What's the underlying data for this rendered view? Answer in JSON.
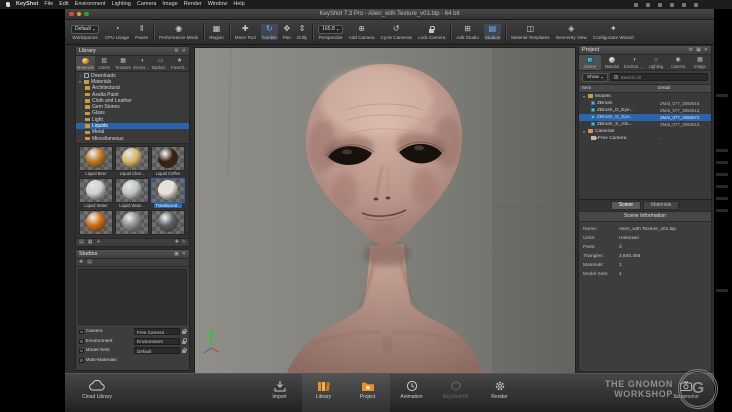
{
  "colors": {
    "selection_blue": "#2a64ad",
    "keyshot_orange": "#e8912d"
  },
  "menubar": {
    "items": [
      "KeyShot",
      "File",
      "Edit",
      "Environment",
      "Lighting",
      "Camera",
      "Image",
      "Render",
      "Window",
      "Help"
    ]
  },
  "window": {
    "title": "KeyShot 7.3 Pro - Alien_with Texture_v01.bip - 64 bit"
  },
  "toolbar": {
    "items": [
      {
        "label": "Workspaces",
        "value": "Default"
      },
      {
        "label": "CPU Usage"
      },
      {
        "label": "Pause"
      },
      {
        "label": "Performance Mode"
      },
      {
        "label": "Region"
      },
      {
        "label": "Move Tool"
      },
      {
        "label": "Tumble"
      },
      {
        "label": "Pan"
      },
      {
        "label": "Dolly"
      },
      {
        "label": "Perspective",
        "value": "165.8"
      },
      {
        "label": "Add Camera"
      },
      {
        "label": "Cycle Cameras"
      },
      {
        "label": "Lock Camera"
      },
      {
        "label": "Add Studio"
      },
      {
        "label": "Studios"
      },
      {
        "label": "Material Templates"
      },
      {
        "label": "Geometry View"
      },
      {
        "label": "Configurator Wizard"
      }
    ]
  },
  "library": {
    "title": "Library",
    "tabs": [
      {
        "label": "Materials"
      },
      {
        "label": "Colors"
      },
      {
        "label": "Textures"
      },
      {
        "label": "Environments"
      },
      {
        "label": "Backplates"
      },
      {
        "label": "Favorites"
      }
    ],
    "tree": [
      {
        "label": "Downloads"
      },
      {
        "label": "Materials"
      },
      {
        "label": "Architectural"
      },
      {
        "label": "Axalta Paint"
      },
      {
        "label": "Cloth and Leather"
      },
      {
        "label": "Gem Stones"
      },
      {
        "label": "Glass"
      },
      {
        "label": "Light"
      },
      {
        "label": "Liquids"
      },
      {
        "label": "Metal"
      },
      {
        "label": "Miscellaneous"
      }
    ],
    "thumbnails": [
      {
        "label": "Liquid Beer",
        "color": "#c07a1e"
      },
      {
        "label": "Liquid Char...",
        "color": "#d9b765"
      },
      {
        "label": "Liquid Coffee",
        "color": "#38200f"
      },
      {
        "label": "Liquid Water",
        "color": "#ccd2d6"
      },
      {
        "label": "Liquid Wate...",
        "color": "#bfc6c9"
      },
      {
        "label": "Translucent...",
        "color": "#e9e2d7"
      },
      {
        "label": "",
        "color": "#d26a12"
      },
      {
        "label": "",
        "color": "#8d9296"
      },
      {
        "label": "",
        "color": "#5d6164"
      }
    ]
  },
  "studios": {
    "title": "Studios",
    "rows": [
      {
        "label": "Camera",
        "value": "Free Camera"
      },
      {
        "label": "Environment",
        "value": "Environment"
      },
      {
        "label": "Model Sets",
        "value": "Default"
      },
      {
        "label": "Multi-Materials",
        "value": ""
      }
    ]
  },
  "project": {
    "title": "Project",
    "tabs": [
      {
        "label": "Scene"
      },
      {
        "label": "Material"
      },
      {
        "label": "Environment"
      },
      {
        "label": "Lighting"
      },
      {
        "label": "Camera"
      },
      {
        "label": "Image"
      }
    ],
    "show_button": "Show",
    "search_placeholder": "Search All",
    "columns": [
      "Item",
      "Detail"
    ],
    "tree": [
      {
        "label": "Models",
        "detail": ""
      },
      {
        "label": "ZBrush",
        "detail": "ZMat_077_2550615"
      },
      {
        "label": "ZBrush_D_Eye...",
        "detail": "ZMat_077_2550613"
      },
      {
        "label": "ZBrush_G_Eye...",
        "detail": "ZMat_077_2550673"
      },
      {
        "label": "ZBrush_S_ASi...",
        "detail": "ZMat_077_2550615"
      },
      {
        "label": "Cameras",
        "detail": ""
      },
      {
        "label": "Free Camera",
        "detail": "-"
      }
    ],
    "bottom_tabs": [
      "Scene",
      "Materials"
    ],
    "scene_information": {
      "title": "Scene Information",
      "rows": [
        {
          "label": "Name:",
          "value": "Alien_with Texture_v01.bip"
        },
        {
          "label": "Units:",
          "value": "Unknown"
        },
        {
          "label": "Parts:",
          "value": "3"
        },
        {
          "label": "Triangles:",
          "value": "2,840,456"
        },
        {
          "label": "Materials:",
          "value": "1"
        },
        {
          "label": "Model Sets:",
          "value": "1"
        }
      ]
    }
  },
  "dock": {
    "items": [
      {
        "label": "Cloud Library"
      },
      {
        "label": "Import"
      },
      {
        "label": "Library"
      },
      {
        "label": "Project"
      },
      {
        "label": "Animation"
      },
      {
        "label": "KeyShotXR"
      },
      {
        "label": "Render"
      },
      {
        "label": "Screenshot"
      }
    ]
  },
  "watermark": {
    "line1": "THE GNOMON",
    "line2": "WORKSHOP"
  }
}
